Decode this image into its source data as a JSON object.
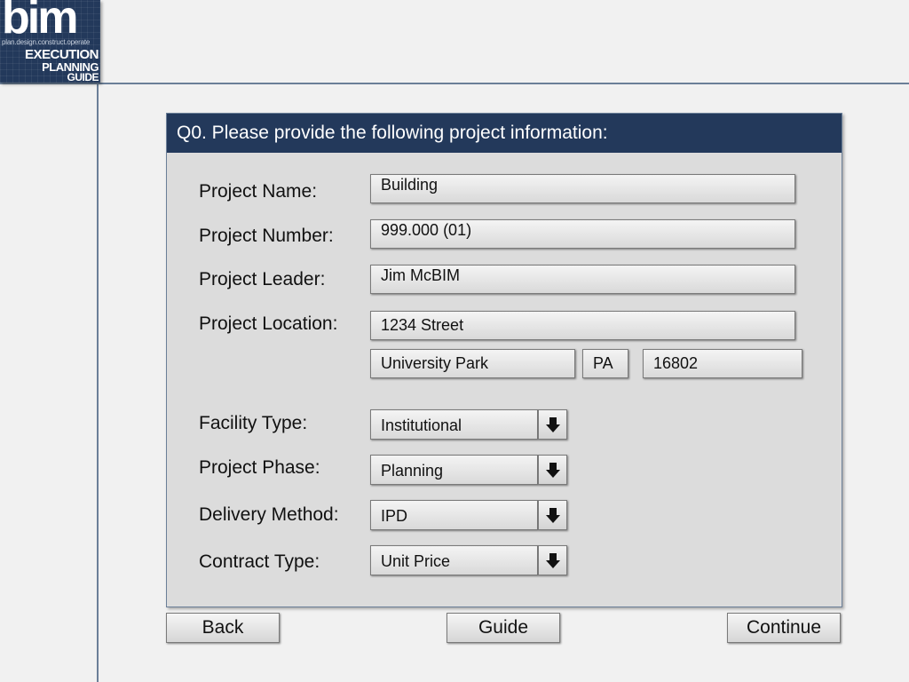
{
  "logo": {
    "brand": "bim",
    "tagline": "plan.design.construct.operate",
    "line1": "EXECUTION",
    "line2": "PLANNING",
    "line3": "GUIDE"
  },
  "question": {
    "title": "Q0.  Please provide the following project information:"
  },
  "fields": {
    "project_name": {
      "label": "Project Name:",
      "value": "Building"
    },
    "project_number": {
      "label": "Project Number:",
      "value": "999.000 (01)"
    },
    "project_leader": {
      "label": "Project Leader:",
      "value": "Jim McBIM"
    },
    "project_location": {
      "label": "Project Location:",
      "street": "1234 Street",
      "city": "University Park",
      "state": "PA",
      "zip": "16802"
    },
    "facility_type": {
      "label": "Facility Type:",
      "value": "Institutional"
    },
    "project_phase": {
      "label": "Project Phase:",
      "value": "Planning"
    },
    "delivery_method": {
      "label": "Delivery Method:",
      "value": "IPD"
    },
    "contract_type": {
      "label": "Contract Type:",
      "value": "Unit Price"
    }
  },
  "buttons": {
    "back": "Back",
    "guide": "Guide",
    "continue": "Continue"
  },
  "colors": {
    "header_bg": "#23395b",
    "panel_bg": "#dcdcdc",
    "page_bg": "#f1f1f1"
  }
}
